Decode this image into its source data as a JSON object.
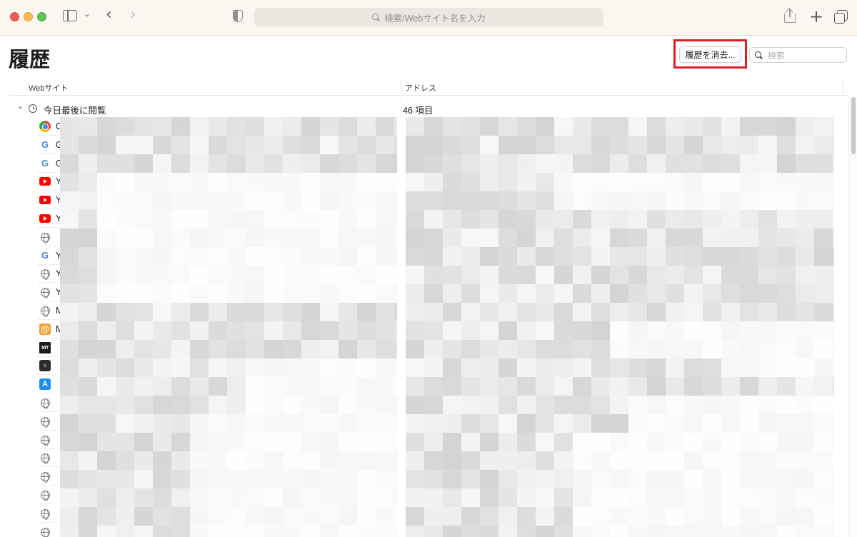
{
  "toolbar": {
    "url_placeholder": "検索/Webサイト名を入力"
  },
  "page": {
    "title": "履歴",
    "clear_button": "履歴を消去...",
    "search_placeholder": "検索"
  },
  "table": {
    "col_site": "Webサイト",
    "col_address": "アドレス"
  },
  "group": {
    "label": "今日最後に閲覧",
    "count": "46 項目"
  },
  "rows": [
    {
      "icon": "chrome-icon",
      "char": "C"
    },
    {
      "icon": "google-icon",
      "char": "G"
    },
    {
      "icon": "google-icon",
      "char": "G"
    },
    {
      "icon": "youtube-icon",
      "char": "Y"
    },
    {
      "icon": "youtube-icon",
      "char": "Y"
    },
    {
      "icon": "youtube-icon",
      "char": "Y"
    },
    {
      "icon": "globe-icon",
      "char": ""
    },
    {
      "icon": "google-icon",
      "char": "Y"
    },
    {
      "icon": "globe-icon",
      "char": "Y"
    },
    {
      "icon": "globe-icon",
      "char": "Y"
    },
    {
      "icon": "globe-icon",
      "char": "M"
    },
    {
      "icon": "mail-icon",
      "char": "M"
    },
    {
      "icon": "mt-icon",
      "char": ""
    },
    {
      "icon": "dark-app-icon",
      "char": ""
    },
    {
      "icon": "app-store-icon",
      "char": ""
    },
    {
      "icon": "globe-icon",
      "char": ""
    },
    {
      "icon": "globe-icon",
      "char": ""
    },
    {
      "icon": "globe-icon",
      "char": ""
    },
    {
      "icon": "globe-icon",
      "char": ""
    },
    {
      "icon": "globe-icon",
      "char": ""
    },
    {
      "icon": "globe-icon",
      "char": ""
    },
    {
      "icon": "globe-icon",
      "char": ""
    },
    {
      "icon": "globe-icon",
      "char": ""
    }
  ],
  "colors": {
    "highlight": "#e31b23",
    "toolbar_bg": "#fbf7f0"
  }
}
